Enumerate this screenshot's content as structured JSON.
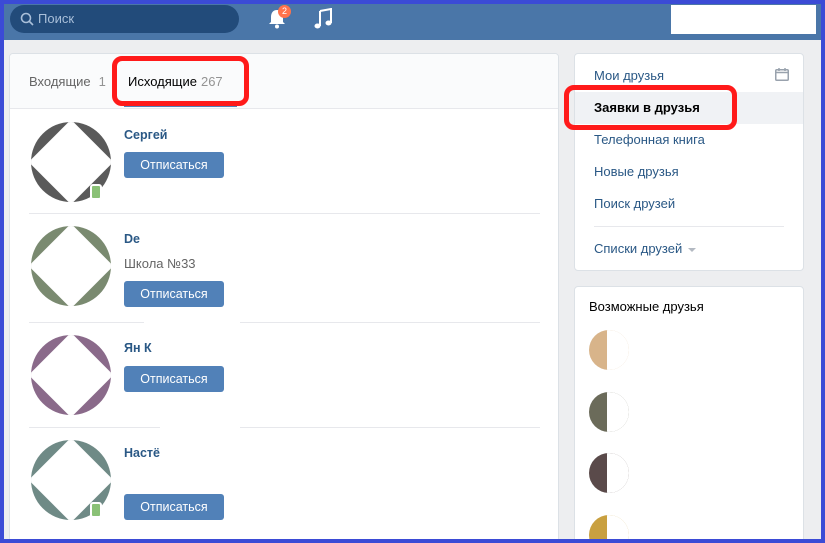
{
  "header": {
    "search_placeholder": "Поиск",
    "notifications_count": "2"
  },
  "tabs": [
    {
      "label": "Входящие",
      "count": "1"
    },
    {
      "label": "Исходящие",
      "count": "267"
    }
  ],
  "requests": [
    {
      "name": "Сергей",
      "subtitle": "",
      "button": "Отписаться",
      "online": true
    },
    {
      "name": "De",
      "subtitle": "Школа №33",
      "button": "Отписаться",
      "online": false
    },
    {
      "name": "Ян К",
      "subtitle": "",
      "button": "Отписаться",
      "online": false
    },
    {
      "name": "Настё",
      "subtitle": "",
      "button": "Отписаться",
      "online": true
    }
  ],
  "sidebar": {
    "items": [
      {
        "label": "Мои друзья"
      },
      {
        "label": "Заявки в друзья"
      },
      {
        "label": "Телефонная книга"
      },
      {
        "label": "Новые друзья"
      },
      {
        "label": "Поиск друзей"
      }
    ],
    "lists_label": "Списки друзей"
  },
  "suggestions": {
    "title": "Возможные друзья"
  },
  "colors": {
    "brand": "#4a76a8",
    "button": "#5181b8",
    "link": "#2a5885",
    "highlight": "#ff1a1a"
  }
}
